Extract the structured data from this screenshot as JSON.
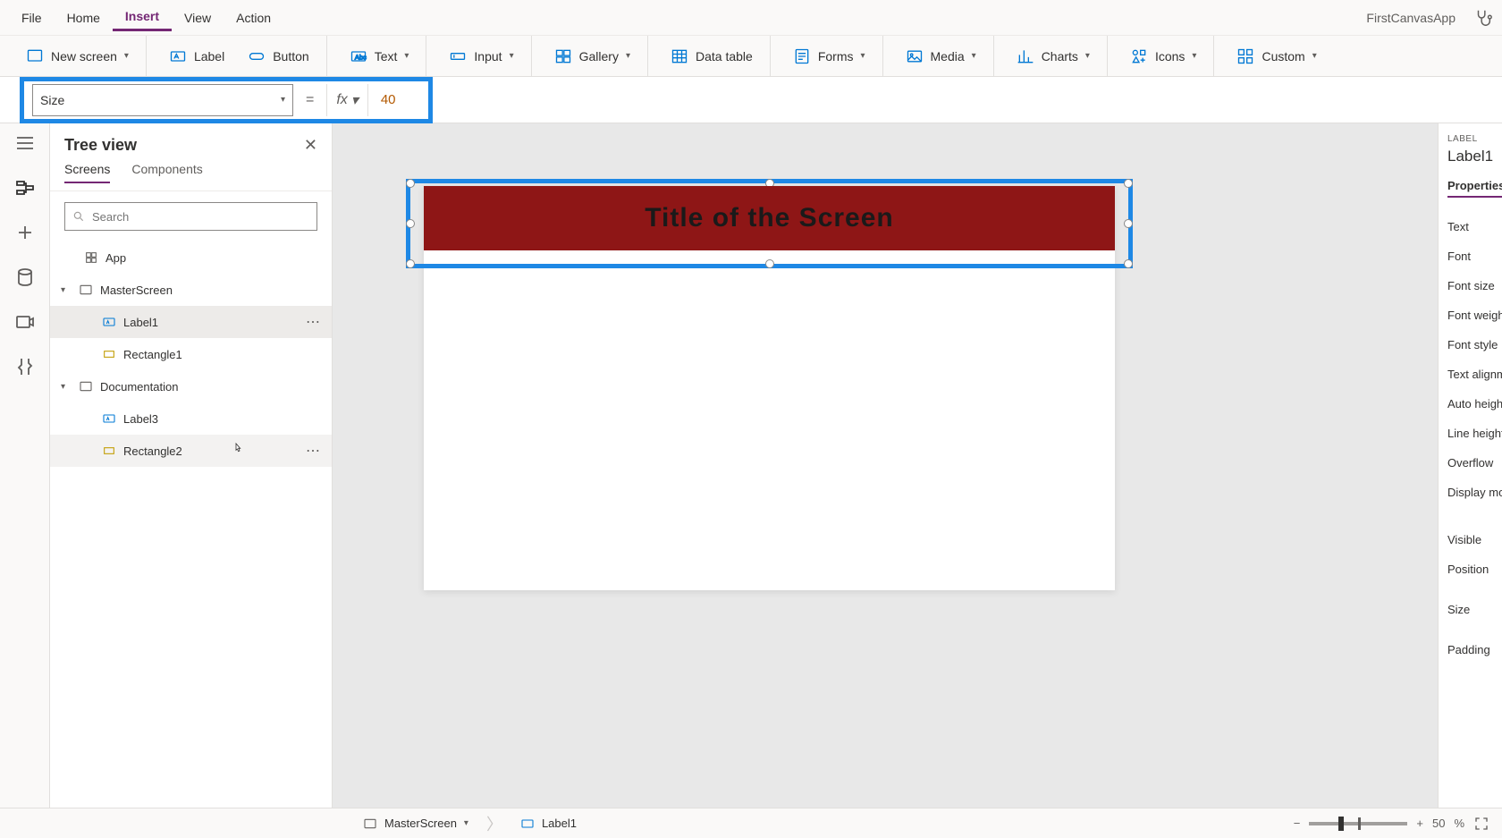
{
  "app_name": "FirstCanvasApp",
  "menu": {
    "file": "File",
    "home": "Home",
    "insert": "Insert",
    "view": "View",
    "action": "Action"
  },
  "ribbon": {
    "new_screen": "New screen",
    "label": "Label",
    "button": "Button",
    "text": "Text",
    "input": "Input",
    "gallery": "Gallery",
    "data_table": "Data table",
    "forms": "Forms",
    "media": "Media",
    "charts": "Charts",
    "icons": "Icons",
    "custom": "Custom"
  },
  "formula": {
    "property": "Size",
    "equals": "=",
    "fx": "fx",
    "value": "40"
  },
  "tree": {
    "title": "Tree view",
    "tab_screens": "Screens",
    "tab_components": "Components",
    "search_placeholder": "Search",
    "app": "App",
    "master": "MasterScreen",
    "label1": "Label1",
    "rect1": "Rectangle1",
    "doc": "Documentation",
    "label3": "Label3",
    "rect2": "Rectangle2"
  },
  "canvas": {
    "title_text": "Title of the Screen"
  },
  "props": {
    "type": "LABEL",
    "name": "Label1",
    "tab": "Properties",
    "rows": [
      "Text",
      "Font",
      "Font size",
      "Font weight",
      "Font style",
      "Text alignment",
      "Auto height",
      "Line height",
      "Overflow",
      "Display mode",
      "Visible",
      "Position",
      "Size",
      "Padding"
    ]
  },
  "breadcrumb": {
    "screen": "MasterScreen",
    "element": "Label1"
  },
  "zoom": {
    "value": "50",
    "pct": "%"
  }
}
